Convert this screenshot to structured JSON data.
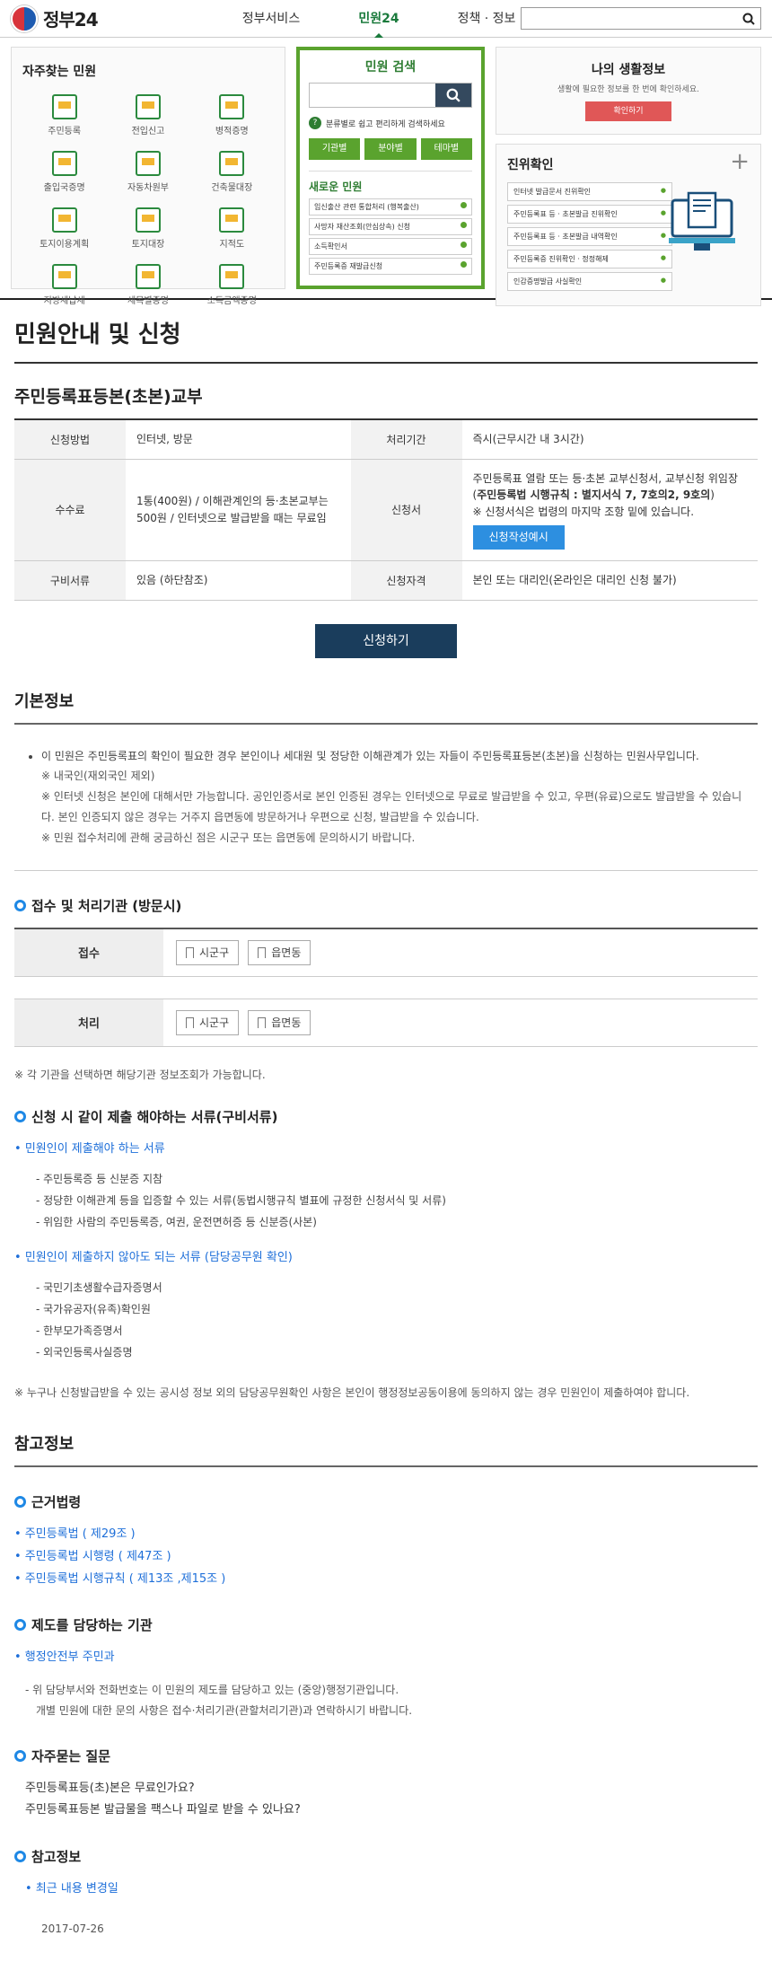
{
  "header": {
    "logo_text": "정부24",
    "nav": [
      "정부서비스",
      "민원24",
      "정책 · 정보"
    ]
  },
  "frequent": {
    "title": "자주찾는 민원",
    "items": [
      "주민등록",
      "전입신고",
      "병적증명",
      "출입국증명",
      "자동차원부",
      "건축물대장",
      "토지이용계획",
      "토지대장",
      "지적도",
      "지방세납세",
      "세목별증명",
      "소득금액증명"
    ]
  },
  "search_panel": {
    "title": "민원 검색",
    "tip": "분류별로 쉽고 편리하게 검색하세요",
    "tabs": [
      "기관별",
      "분야별",
      "테마별"
    ],
    "new_title": "새로운 민원",
    "new_items": [
      "임신출산 관련 통합처리 (행복출산)",
      "사망자 재산조회(안심상속) 신청",
      "소득확인서",
      "주민등록증 재발급신청"
    ]
  },
  "life": {
    "title": "나의 생활정보",
    "desc": "생활에 필요한 정보를 한 번에 확인하세요.",
    "button": "확인하기"
  },
  "verify": {
    "title": "진위확인",
    "items": [
      "인터넷 발급문서 진위확인",
      "주민등록표 등 · 초본발급 진위확인",
      "주민등록표 등 · 초본발급 내역확인",
      "주민등록증 진위확인 · 정정해제",
      "인감증명발급 사실확인"
    ]
  },
  "page_title": "민원안내 및 신청",
  "service_title": "주민등록표등본(초본)교부",
  "info_table": {
    "method_label": "신청방법",
    "method_value": "인터넷, 방문",
    "period_label": "처리기간",
    "period_value": "즉시(근무시간 내 3시간)",
    "fee_label": "수수료",
    "fee_value": "1통(400원) / 이해관계인의 등·초본교부는 500원 / 인터넷으로 발급받을 때는 무료임",
    "form_label": "신청서",
    "form_value_1": "주민등록표 열람 또는 등·초본 교부신청서, 교부신청 위임장 (",
    "form_value_bold": "주민등록법 시행규칙 : 별지서식 7, 7호의2, 9호의",
    "form_value_2": ")",
    "form_note": "※ 신청서식은 법령의 마지막 조항 밑에 있습니다.",
    "form_button": "신청작성예시",
    "docs_label": "구비서류",
    "docs_value": "있음 (하단참조)",
    "qual_label": "신청자격",
    "qual_value": "본인 또는 대리인(온라인은 대리인 신청 불가)"
  },
  "apply_button": "신청하기",
  "basic_info": {
    "title": "기본정보",
    "main": "이 민원은 주민등록표의 확인이 필요한 경우 본인이나 세대원 및 정당한 이해관계가 있는 자들이 주민등록표등본(초본)을 신청하는 민원사무입니다.",
    "note1": "※ 내국인(재외국인 제외)",
    "note2": "※ 인터넷 신청은 본인에 대해서만 가능합니다. 공인인증서로 본인 인증된 경우는 인터넷으로 무료로 발급받을 수 있고, 우편(유료)으로도 발급받을 수 있습니다. 본인 인증되지 않은 경우는 거주지 읍면동에 방문하거나 우편으로 신청, 발급받을 수 있습니다.",
    "note3": "※ 민원 접수처리에 관해 궁금하신 점은 시군구 또는 읍면동에 문의하시기 바랍니다."
  },
  "processing": {
    "title": "접수 및 처리기관 (방문시)",
    "receive_label": "접수",
    "process_label": "처리",
    "chip1": "시군구",
    "chip2": "읍면동",
    "note": "※ 각 기관을 선택하면 해당기관 정보조회가 가능합니다."
  },
  "required_docs": {
    "title": "신청 시 같이 제출 해야하는 서류(구비서류)",
    "group1_title": "민원인이 제출해야 하는 서류",
    "group1_items": [
      "- 주민등록증 등 신분증 지참",
      "- 정당한 이해관계 등을 입증할 수 있는 서류(동법시행규칙 별표에 규정한 신청서식 및 서류)",
      "- 위임한 사람의 주민등록증, 여권, 운전면허증 등 신분증(사본)"
    ],
    "group2_title": "민원인이 제출하지 않아도 되는 서류 (담당공무원 확인)",
    "group2_items": [
      "- 국민기초생활수급자증명서",
      "- 국가유공자(유족)확인원",
      "- 한부모가족증명서",
      "- 외국인등록사실증명"
    ],
    "note": "※ 누구나 신청발급받을 수 있는 공시성 정보 외의 담당공무원확인 사항은 본인이 행정정보공동이용에 동의하지 않는 경우 민원인이 제출하여야 합니다."
  },
  "reference": {
    "title": "참고정보",
    "law_title": "근거법령",
    "laws": [
      "• 주민등록법 ( 제29조 )",
      "• 주민등록법 시행령 ( 제47조 )",
      "• 주민등록법 시행규칙 ( 제13조 ,제15조 )"
    ],
    "org_title": "제도를 담당하는 기관",
    "org_link": "• 행정안전부 주민과",
    "org_text1": "- 위 담당부서와 전화번호는 이 민원의 제도를 담당하고 있는 (중앙)행정기관입니다.",
    "org_text2": "개별 민원에 대한 문의 사항은 접수·처리기관(관할처리기관)과 연락하시기 바랍니다.",
    "faq_title": "자주묻는 질문",
    "faqs": [
      "주민등록표등(초)본은 무료인가요?",
      "주민등록표등본 발급물을 팩스나 파일로 받을 수 있나요?"
    ],
    "ref_title": "참고정보",
    "recent_link": "• 최근 내용 변경일",
    "date": "2017-07-26"
  }
}
